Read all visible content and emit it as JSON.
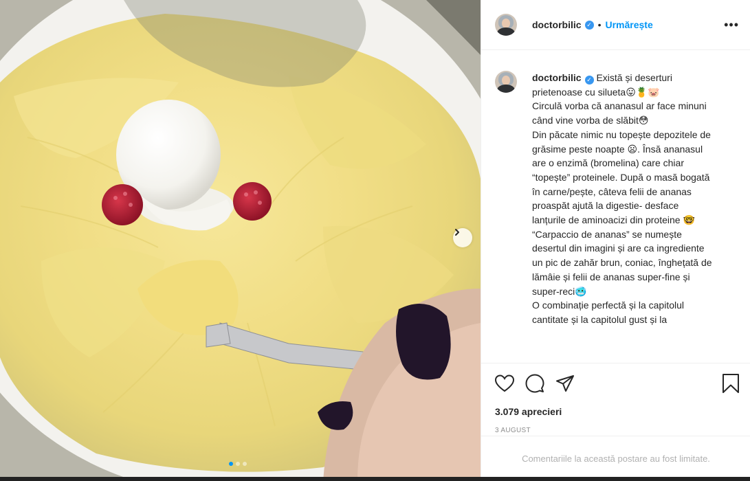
{
  "post": {
    "username": "doctorbilic",
    "follow_label": "Urmărește",
    "separator": "•",
    "more_label": "•••",
    "caption_lines": [
      "Există și deserturi prietenoase cu silueta😛🍍🐷",
      "Circulă vorba că ananasul ar face minuni când vine vorba de slăbit😳",
      "Din păcate nimic nu topește depozitele de grăsime peste noapte 😦. Însă ananasul are o enzimă (bromelina) care chiar “topește” proteinele. După o masă bogată în carne/pește, câteva felii de ananas proaspăt ajută la digestie- desface lanțurile de aminoacizi din proteine 🤓",
      "“Carpaccio de ananas” se numește desertul din imagini și are ca ingrediente un pic de zahăr brun, coniac, înghețată de lămâie și felii de ananas super-fine și super-reci🥶",
      "O combinație perfectă și la capitolul cantitate și la capitolul gust și la"
    ],
    "likes": "3.079 aprecieri",
    "date": "3 AUGUST",
    "comments_limited": "Comentariile la această postare au fost limitate."
  },
  "carousel": {
    "total": 3,
    "active_index": 0
  },
  "colors": {
    "accent": "#0095f6",
    "verified": "#3897f0",
    "text": "#262626",
    "muted": "#8e8e8e"
  },
  "icons": [
    "heart-icon",
    "comment-icon",
    "share-icon",
    "bookmark-icon",
    "chevron-right-icon",
    "verified-icon",
    "more-icon"
  ]
}
